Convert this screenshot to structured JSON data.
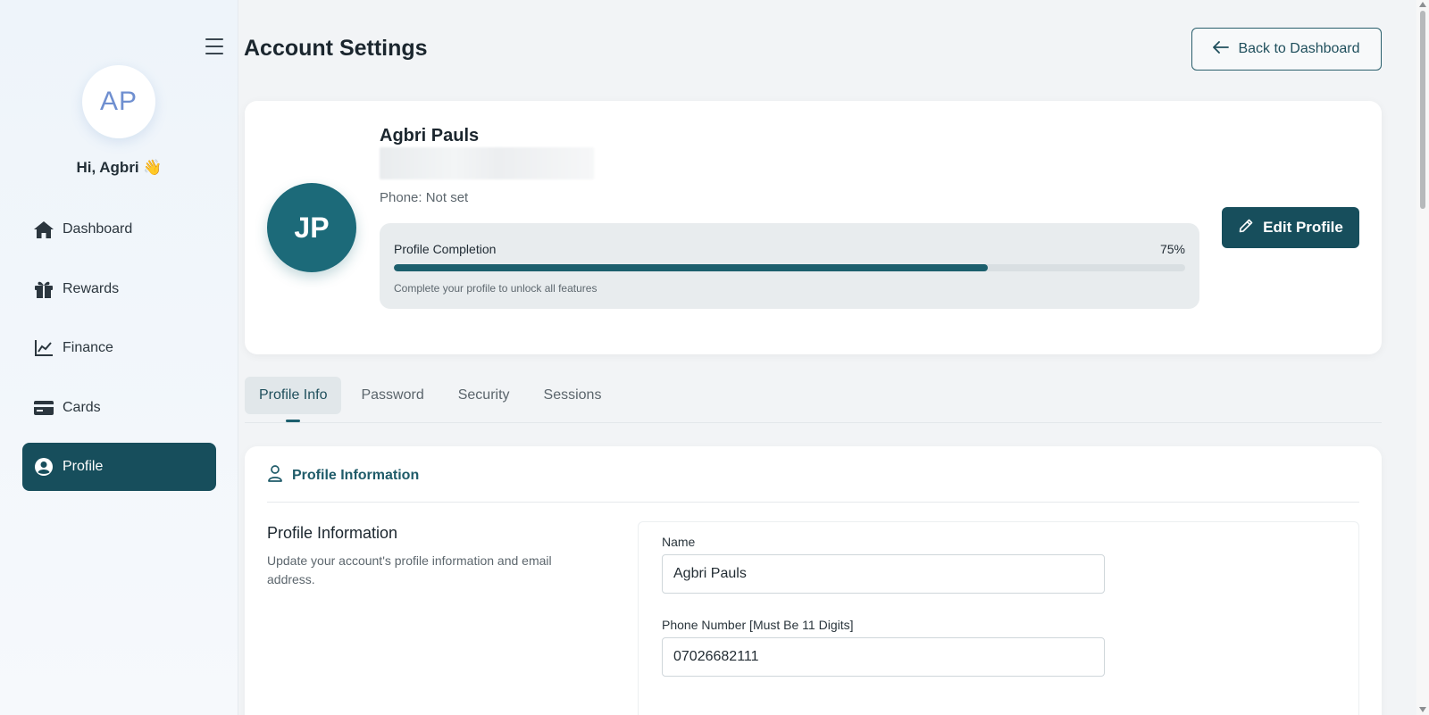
{
  "sidebar": {
    "avatar_initials": "AP",
    "greeting": "Hi, Agbri 👋",
    "items": [
      {
        "label": "Dashboard",
        "icon": "home-icon"
      },
      {
        "label": "Rewards",
        "icon": "gift-icon"
      },
      {
        "label": "Finance",
        "icon": "chart-line-icon"
      },
      {
        "label": "Cards",
        "icon": "credit-card-icon"
      },
      {
        "label": "Profile",
        "icon": "user-circle-icon",
        "active": true
      }
    ]
  },
  "header": {
    "title": "Account Settings",
    "back_label": "Back to Dashboard"
  },
  "profile": {
    "initials": "JP",
    "name": "Agbri Pauls",
    "phone": "Phone: Not set",
    "completion_label": "Profile Completion",
    "completion_percent_text": "75%",
    "completion_value": 0.75,
    "completion_hint": "Complete your profile to unlock all features",
    "edit_label": "Edit Profile"
  },
  "tabs": [
    {
      "label": "Profile Info",
      "active": true
    },
    {
      "label": "Password"
    },
    {
      "label": "Security"
    },
    {
      "label": "Sessions"
    }
  ],
  "info": {
    "heading": "Profile Information",
    "section_title": "Profile Information",
    "section_desc": "Update your account's profile information and email address.",
    "name_label": "Name",
    "name_value": "Agbri Pauls",
    "phone_label": "Phone Number [Must Be 11 Digits]",
    "phone_value": "07026682111"
  },
  "colors": {
    "accent": "#174e5c",
    "progress": "#1c5f6d",
    "avatar_bg": "#1c6a79"
  }
}
